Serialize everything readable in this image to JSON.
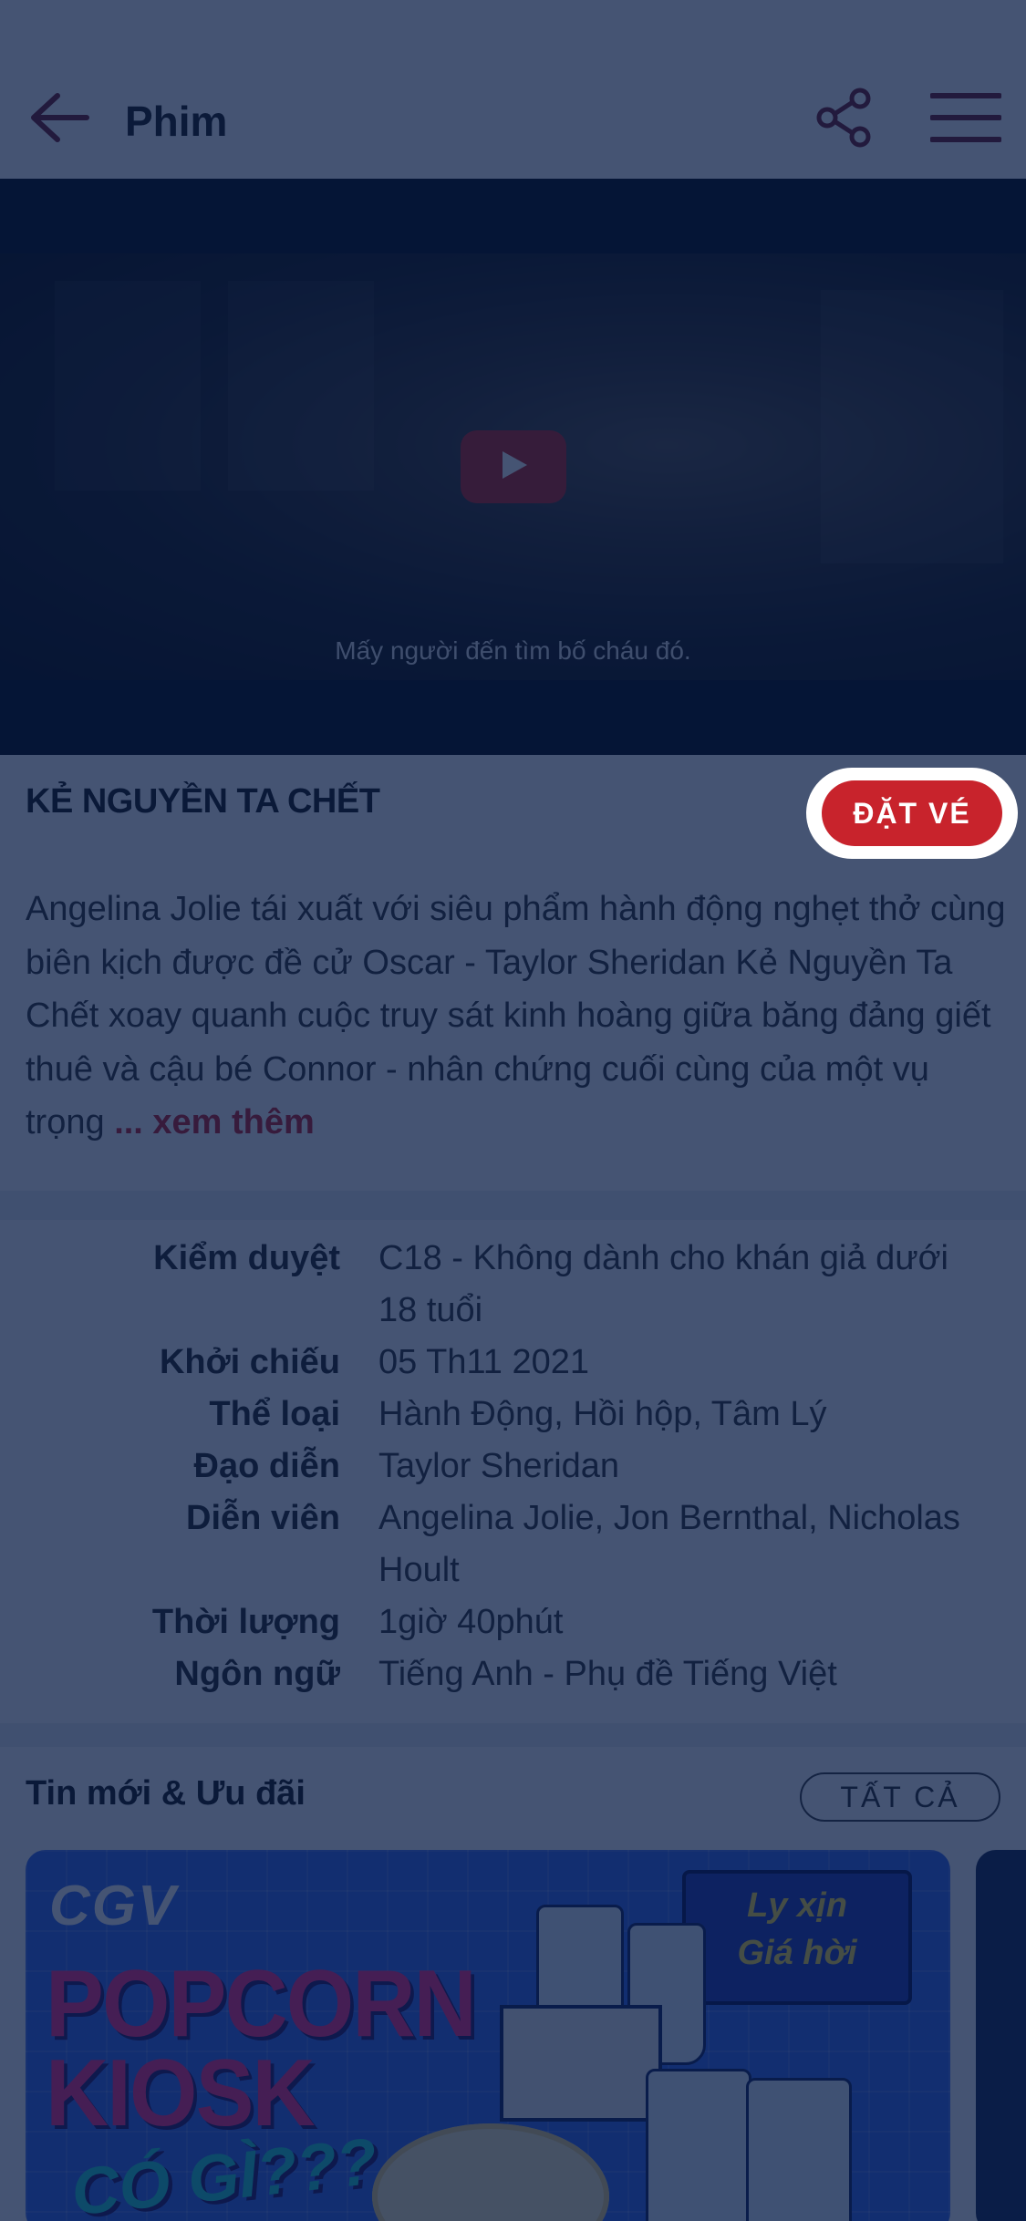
{
  "header": {
    "title": "Phim",
    "back_icon": "arrow-left-icon",
    "share_icon": "share-icon",
    "menu_icon": "hamburger-menu-icon"
  },
  "video": {
    "subtitle": "Mấy người đến tìm bố cháu đó.",
    "play_icon": "play-icon"
  },
  "movie": {
    "title": "KẺ NGUYỀN TA CHẾT",
    "book_label": "ĐẶT VÉ",
    "description": "Angelina Jolie tái xuất với siêu phẩm hành động nghẹt thở cùng biên kịch được đề cử Oscar - Taylor Sheridan Kẻ Nguyền Ta Chết xoay quanh cuộc truy sát kinh hoàng giữa băng đảng giết thuê và cậu bé Connor - nhân chứng cuối cùng của một vụ trọng",
    "more_label": "... xem thêm"
  },
  "details": [
    {
      "label": "Kiểm duyệt",
      "value": "C18 - Không dành cho khán giả dưới 18 tuổi"
    },
    {
      "label": "Khởi chiếu",
      "value": "05 Th11 2021"
    },
    {
      "label": "Thể loại",
      "value": "Hành Động, Hồi hộp, Tâm Lý"
    },
    {
      "label": "Đạo diễn",
      "value": "Taylor Sheridan"
    },
    {
      "label": "Diễn viên",
      "value": "Angelina Jolie, Jon Bernthal, Nicholas Hoult"
    },
    {
      "label": "Thời lượng",
      "value": "1giờ 40phút"
    },
    {
      "label": "Ngôn ngữ",
      "value": "Tiếng Anh - Phụ đề Tiếng Việt"
    }
  ],
  "news": {
    "title": "Tin mới & Ưu đãi",
    "all_label": "TẤT CẢ",
    "banner": {
      "brand": "CGV",
      "line1": "POPCORN",
      "line2": "KIOSK",
      "line3": "CÓ GÌ???",
      "sign_line1": "Ly xịn",
      "sign_line2": "Giá hời"
    }
  },
  "colors": {
    "accent": "#c8232c",
    "overlay": "#04183f"
  }
}
